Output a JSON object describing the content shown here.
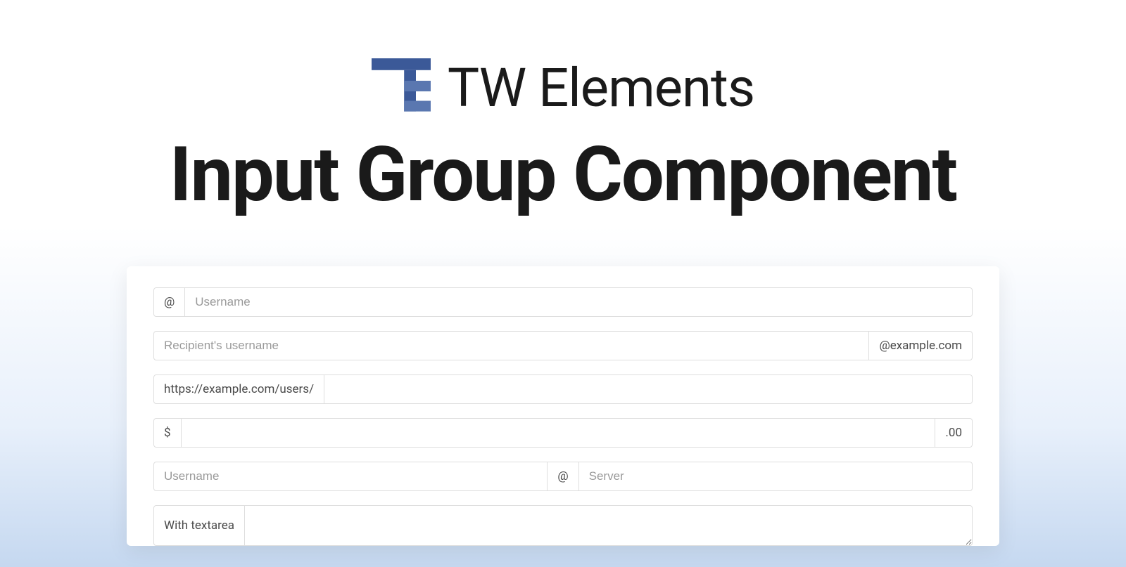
{
  "brand": {
    "name": "TW Elements",
    "logoColor": "#3b5998"
  },
  "title": "Input Group Component",
  "groups": {
    "g1": {
      "prefix": "@",
      "placeholder": "Username"
    },
    "g2": {
      "placeholder": "Recipient's username",
      "suffix": "@example.com"
    },
    "g3": {
      "prefix": "https://example.com/users/"
    },
    "g4": {
      "prefix": "$",
      "suffix": ".00"
    },
    "g5": {
      "leftPlaceholder": "Username",
      "middle": "@",
      "rightPlaceholder": "Server"
    },
    "g6": {
      "prefix": "With textarea"
    }
  }
}
